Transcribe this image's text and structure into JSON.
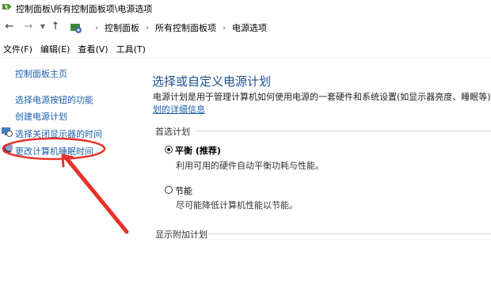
{
  "window": {
    "title": "控制面板\\所有控制面板项\\电源选项"
  },
  "address": {
    "crumbs": [
      "控制面板",
      "所有控制面板项",
      "电源选项"
    ]
  },
  "menu": {
    "items": [
      "文件(F)",
      "编辑(E)",
      "查看(V)",
      "工具(T)"
    ]
  },
  "sidebar": {
    "items": [
      {
        "label": "控制面板主页"
      },
      {
        "label": "选择电源按钮的功能"
      },
      {
        "label": "创建电源计划"
      },
      {
        "label": "选择关闭显示器的时间"
      },
      {
        "label": "更改计算机睡眠时间"
      }
    ]
  },
  "main": {
    "title": "选择或自定义电源计划",
    "description": "电源计划是用于管理计算机如何使用电源的一套硬件和系统设置(如显示器亮度、睡眠等)。",
    "more_link": "划的详细信息",
    "preferred_heading": "首选计划",
    "plans": [
      {
        "name": "平衡 (推荐)",
        "desc": "利用可用的硬件自动平衡功耗与性能。",
        "selected": true
      },
      {
        "name": "节能",
        "desc": "尽可能降低计算机性能以节能。",
        "selected": false
      }
    ],
    "additional_heading": "显示附加计划"
  },
  "colors": {
    "link": "#1c5fa9",
    "title": "#1e4f8f",
    "annotation": "#e8322a"
  },
  "icons": {
    "app": "power-options-icon",
    "back": "arrow-left-icon",
    "forward": "arrow-right-icon",
    "up": "arrow-up-icon",
    "display": "monitor-clock-icon",
    "sleep": "moon-icon"
  }
}
